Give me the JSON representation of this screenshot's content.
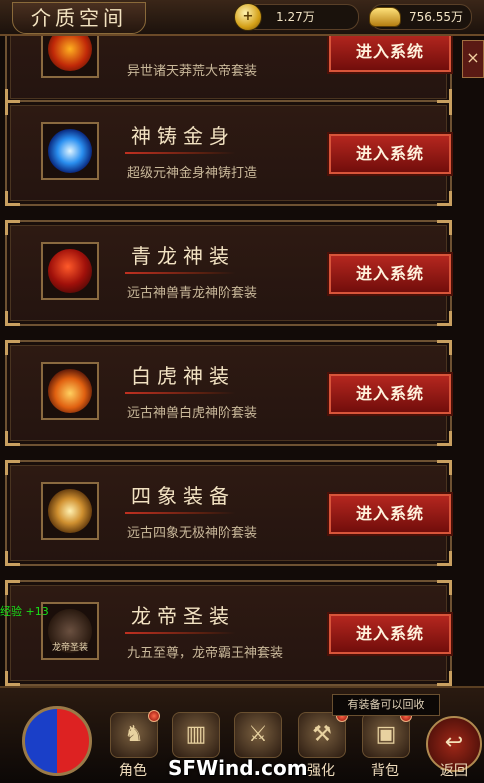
{
  "header": {
    "title": "介质空间",
    "currency1": {
      "value": "1.27万",
      "icon": "coin-plus-icon"
    },
    "currency2": {
      "value": "756.55万",
      "icon": "gold-ingot-icon"
    }
  },
  "cards": [
    {
      "name": "",
      "desc": "异世诸天莽荒大帝套装",
      "button": "进入系统",
      "icon": "fire-emblem-icon"
    },
    {
      "name": "神铸金身",
      "desc": "超级元神金身神铸打造",
      "button": "进入系统",
      "icon": "eye-rune-icon"
    },
    {
      "name": "青龙神装",
      "desc": "远古神兽青龙神阶套装",
      "button": "进入系统",
      "icon": "dragon-icon"
    },
    {
      "name": "白虎神装",
      "desc": "远古神兽白虎神阶套装",
      "button": "进入系统",
      "icon": "tiger-flame-icon"
    },
    {
      "name": "四象装备",
      "desc": "远古四象无极神阶套装",
      "button": "进入系统",
      "icon": "four-symbols-icon"
    },
    {
      "name": "龙帝圣装",
      "desc": "九五至尊，龙帝霸王神套装",
      "button": "进入系统",
      "icon": "dragon-emperor-icon",
      "icon_text": "龙帝圣装"
    }
  ],
  "side_exp": "经验 +13",
  "tooltip": "有装备可以回收",
  "bottom_nav": [
    {
      "label": "角色",
      "icon": "character-icon"
    },
    {
      "label": "",
      "icon": "book-icon"
    },
    {
      "label": "",
      "icon": "cross-swords-icon"
    },
    {
      "label": "强化",
      "icon": "anvil-icon"
    },
    {
      "label": "背包",
      "icon": "bag-icon"
    }
  ],
  "back_label": "返回",
  "watermark": "SFWind.com",
  "colors": {
    "accent": "#b82820",
    "gold": "#c9a060",
    "panel": "#2e1a12"
  }
}
